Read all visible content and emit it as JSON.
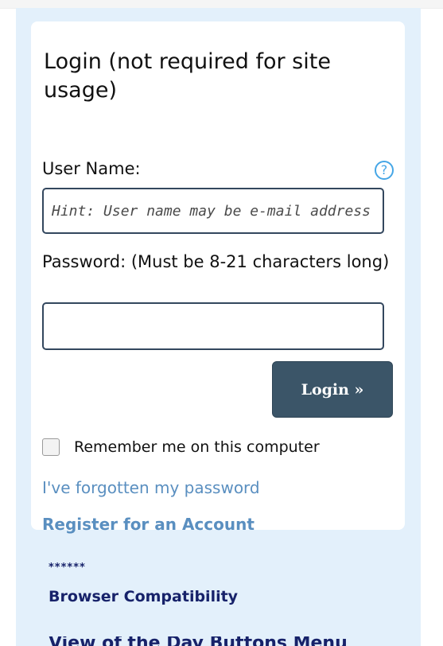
{
  "login": {
    "title": "Login (not required for site usage)",
    "username_label": "User Name:",
    "username_placeholder": "Hint: User name may be e-mail address",
    "help_icon": "?",
    "password_label": "Password: (Must be 8-21 characters long)",
    "password_value": "",
    "login_button": "Login »",
    "remember_label": "Remember me on this computer",
    "remember_checked": false,
    "forgot_link": "I've forgotten my password",
    "register_link": "Register for an Account"
  },
  "sidebar": {
    "stars_link": "******",
    "compat_link": "Browser Compatibility",
    "cut_link": "View of the Day Buttons Menu"
  },
  "colors": {
    "panel_bg": "#e3f0fb",
    "button_bg": "#3b5568",
    "link_light": "#5a8fc0",
    "link_dark": "#17226a",
    "help_icon": "#45a6e6"
  }
}
